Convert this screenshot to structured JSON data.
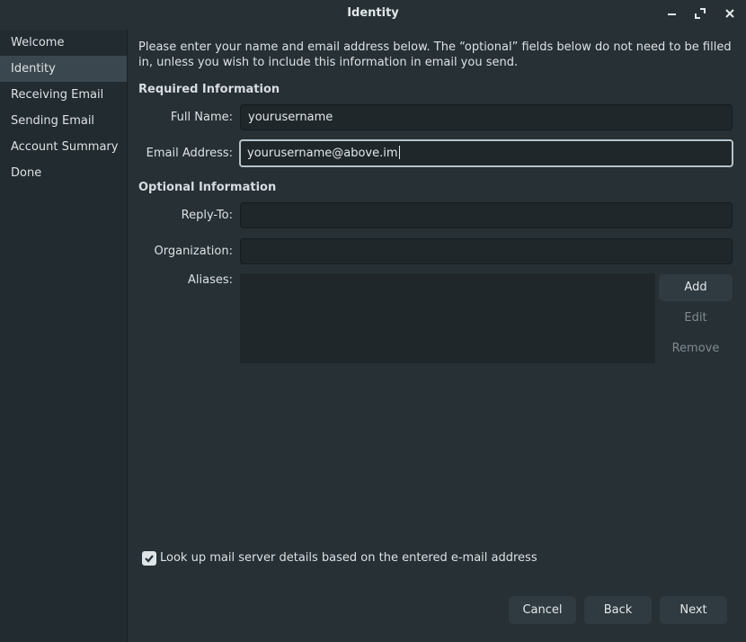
{
  "window": {
    "title": "Identity",
    "buttons": {
      "minimize": "minimize-icon",
      "maximize": "maximize-icon",
      "close": "close-icon"
    }
  },
  "sidebar": {
    "items": [
      {
        "label": "Welcome",
        "active": false
      },
      {
        "label": "Identity",
        "active": true
      },
      {
        "label": "Receiving Email",
        "active": false
      },
      {
        "label": "Sending Email",
        "active": false
      },
      {
        "label": "Account Summary",
        "active": false
      },
      {
        "label": "Done",
        "active": false
      }
    ]
  },
  "main": {
    "intro": "Please enter your name and email address below. The “optional” fields below do not need to be filled in, unless you wish to include this information in email you send.",
    "required_heading": "Required Information",
    "optional_heading": "Optional Information",
    "full_name": {
      "label": "Full Name:",
      "value": "yourusername"
    },
    "email": {
      "label": "Email Address:",
      "value": "yourusername@above.im"
    },
    "reply_to": {
      "label": "Reply-To:",
      "value": ""
    },
    "organization": {
      "label": "Organization:",
      "value": ""
    },
    "aliases": {
      "label": "Aliases:",
      "add": "Add",
      "edit": "Edit",
      "remove": "Remove"
    },
    "lookup": {
      "label": "Look up mail server details based on the entered e-mail address",
      "checked": true
    }
  },
  "footer": {
    "cancel": "Cancel",
    "back": "Back",
    "next": "Next"
  },
  "colors": {
    "background": "#263035",
    "sidebar": "#222b30",
    "active_item": "#3a474e",
    "field": "#1f272b",
    "button": "#2f3b41"
  }
}
